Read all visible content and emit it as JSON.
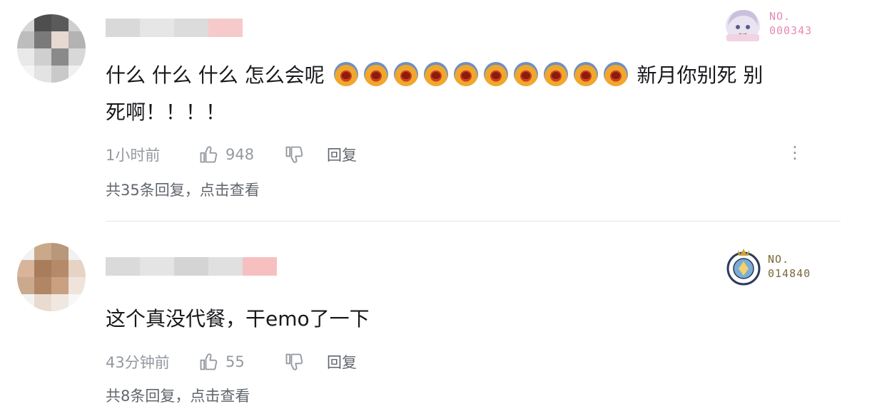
{
  "comments": [
    {
      "text_before": "什么 什么 什么 怎么会呢",
      "emoji_icon": "crying-face-emoji",
      "emoji_count": 10,
      "text_after": " 新月你别死 别",
      "text_line2": "死啊！！！！",
      "time": "1小时前",
      "likes": "948",
      "reply_label": "回复",
      "replies_summary": "共35条回复，点击查看",
      "badge": {
        "line1": "NO.",
        "line2": "000343",
        "color": "#e48bb3"
      }
    },
    {
      "text": "这个真没代餐，干emo了一下",
      "time": "43分钟前",
      "likes": "55",
      "reply_label": "回复",
      "replies_summary": "共8条回复，点击查看",
      "badge": {
        "line1": "NO.",
        "line2": "014840",
        "color": "#7a6a3a"
      }
    }
  ],
  "more_icon": "more-vertical-icon"
}
